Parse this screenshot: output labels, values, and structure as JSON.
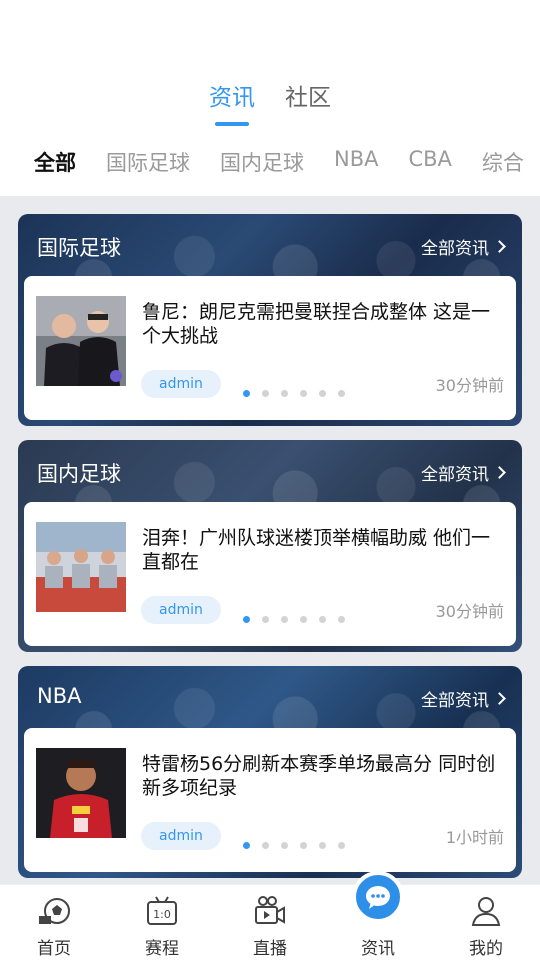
{
  "main_tabs": [
    {
      "label": "资讯",
      "active": true
    },
    {
      "label": "社区",
      "active": false
    }
  ],
  "category_tabs": [
    {
      "label": "全部",
      "active": true
    },
    {
      "label": "国际足球"
    },
    {
      "label": "国内足球"
    },
    {
      "label": "NBA"
    },
    {
      "label": "CBA"
    },
    {
      "label": "综合"
    }
  ],
  "sections": [
    {
      "title": "国际足球",
      "more_label": "全部资讯",
      "news": {
        "title": "鲁尼：朗尼克需把曼联捏合成整体 这是一个大挑战",
        "author": "admin",
        "time": "30分钟前",
        "dots_total": 6,
        "dot_active_index": 0
      }
    },
    {
      "title": "国内足球",
      "more_label": "全部资讯",
      "news": {
        "title": "泪奔！广州队球迷楼顶举横幅助威 他们一直都在",
        "author": "admin",
        "time": "30分钟前",
        "dots_total": 6,
        "dot_active_index": 0
      }
    },
    {
      "title": "NBA",
      "more_label": "全部资讯",
      "news": {
        "title": "特雷杨56分刷新本赛季单场最高分 同时创新多项纪录",
        "author": "admin",
        "time": "1小时前",
        "dots_total": 6,
        "dot_active_index": 0
      }
    }
  ],
  "bottom_nav": [
    {
      "label": "首页",
      "icon": "football-home-icon"
    },
    {
      "label": "赛程",
      "icon": "scoreboard-icon"
    },
    {
      "label": "直播",
      "icon": "video-camera-icon"
    },
    {
      "label": "资讯",
      "icon": "chat-bubble-icon",
      "active": true
    },
    {
      "label": "我的",
      "icon": "user-icon"
    }
  ],
  "colors": {
    "accent": "#3396f0",
    "active_text": "#111111",
    "muted_text": "#9a9a9a"
  }
}
